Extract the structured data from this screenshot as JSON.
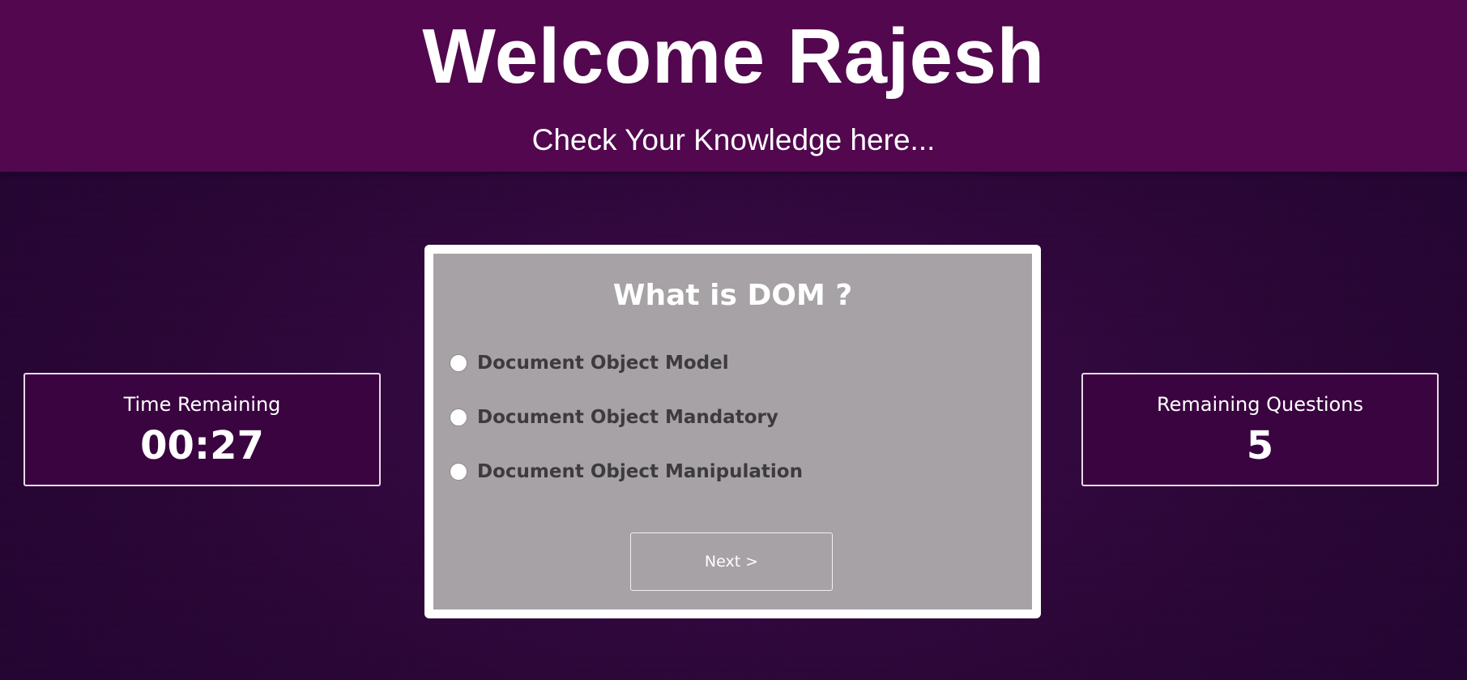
{
  "header": {
    "title": "Welcome Rajesh",
    "subtitle": "Check Your Knowledge here..."
  },
  "timer": {
    "label": "Time Remaining",
    "value": "00:27"
  },
  "remaining": {
    "label": "Remaining Questions",
    "value": "5"
  },
  "quiz": {
    "question": "What is DOM ?",
    "options": [
      {
        "label": "Document Object Model",
        "selected": false
      },
      {
        "label": "Document Object Mandatory",
        "selected": false
      },
      {
        "label": "Document Object Manipulation",
        "selected": false
      }
    ],
    "next_label": "Next >"
  },
  "colors": {
    "header_bg": "#52074f",
    "page_bg": "#2a0536",
    "card_bg": "#a6a2a5",
    "stat_bg": "#3a0440"
  }
}
